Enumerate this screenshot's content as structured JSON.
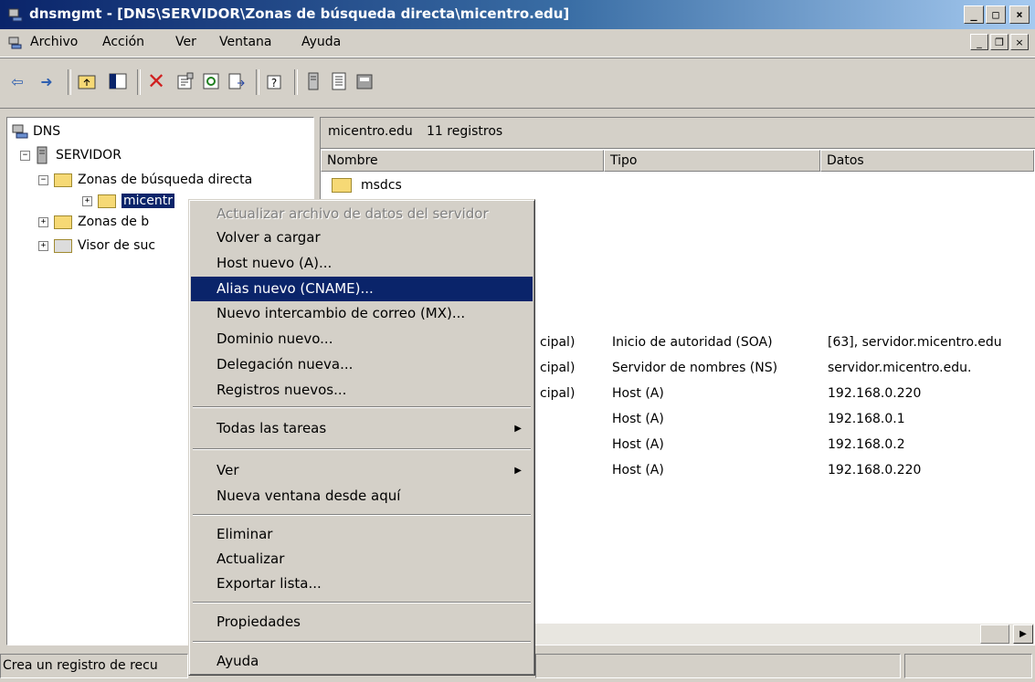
{
  "window": {
    "title": "dnsmgmt - [DNS\\SERVIDOR\\Zonas de búsqueda directa\\micentro.edu]",
    "controls": [
      "_",
      "□",
      "×"
    ]
  },
  "menubar": {
    "items": [
      "Archivo",
      "Acción",
      "Ver",
      "Ventana",
      "Ayuda"
    ],
    "mdi_controls": [
      "_",
      "❐",
      "×"
    ]
  },
  "tree": {
    "root": "DNS",
    "server": "SERVIDOR",
    "forward_zones": "Zonas de búsqueda directa",
    "zone": "micentro.edu",
    "zone_partial": "micentr",
    "reverse_zones_partial": "Zonas de b",
    "event_viewer_partial": "Visor de suc"
  },
  "list": {
    "zone_label": "micentro.edu",
    "count_label": "11 registros",
    "columns": [
      "Nombre",
      "Tipo",
      "Datos"
    ],
    "rows": [
      {
        "name": "msdcs",
        "type": "",
        "data": ""
      },
      {
        "name": "cipal)",
        "type": "Inicio de autoridad (SOA)",
        "data": "[63], servidor.micentro.edu"
      },
      {
        "name": "cipal)",
        "type": "Servidor de nombres (NS)",
        "data": "servidor.micentro.edu."
      },
      {
        "name": "cipal)",
        "type": "Host (A)",
        "data": "192.168.0.220"
      },
      {
        "name": "",
        "type": "Host (A)",
        "data": "192.168.0.1"
      },
      {
        "name": "",
        "type": "Host (A)",
        "data": "192.168.0.2"
      },
      {
        "name": "",
        "type": "Host (A)",
        "data": "192.168.0.220"
      }
    ]
  },
  "context_menu": {
    "items": [
      {
        "label": "Actualizar archivo de datos del servidor",
        "disabled": true
      },
      {
        "label": "Volver a cargar"
      },
      {
        "label": "Host nuevo (A)..."
      },
      {
        "label": "Alias nuevo (CNAME)...",
        "selected": true
      },
      {
        "label": "Nuevo intercambio de correo (MX)..."
      },
      {
        "label": "Dominio nuevo..."
      },
      {
        "label": "Delegación nueva..."
      },
      {
        "label": "Registros nuevos..."
      },
      {
        "label": "Todas las tareas",
        "submenu": true
      },
      {
        "label": "Ver",
        "submenu": true
      },
      {
        "label": "Nueva ventana desde aquí"
      },
      {
        "label": "Eliminar"
      },
      {
        "label": "Actualizar"
      },
      {
        "label": "Exportar lista..."
      },
      {
        "label": "Propiedades"
      },
      {
        "label": "Ayuda"
      }
    ]
  },
  "status": {
    "text": "Crea un registro de recu"
  },
  "colors": {
    "title_start": "#0a246a",
    "title_end": "#a6caf0",
    "selection": "#0a246a",
    "face": "#d4d0c8"
  }
}
